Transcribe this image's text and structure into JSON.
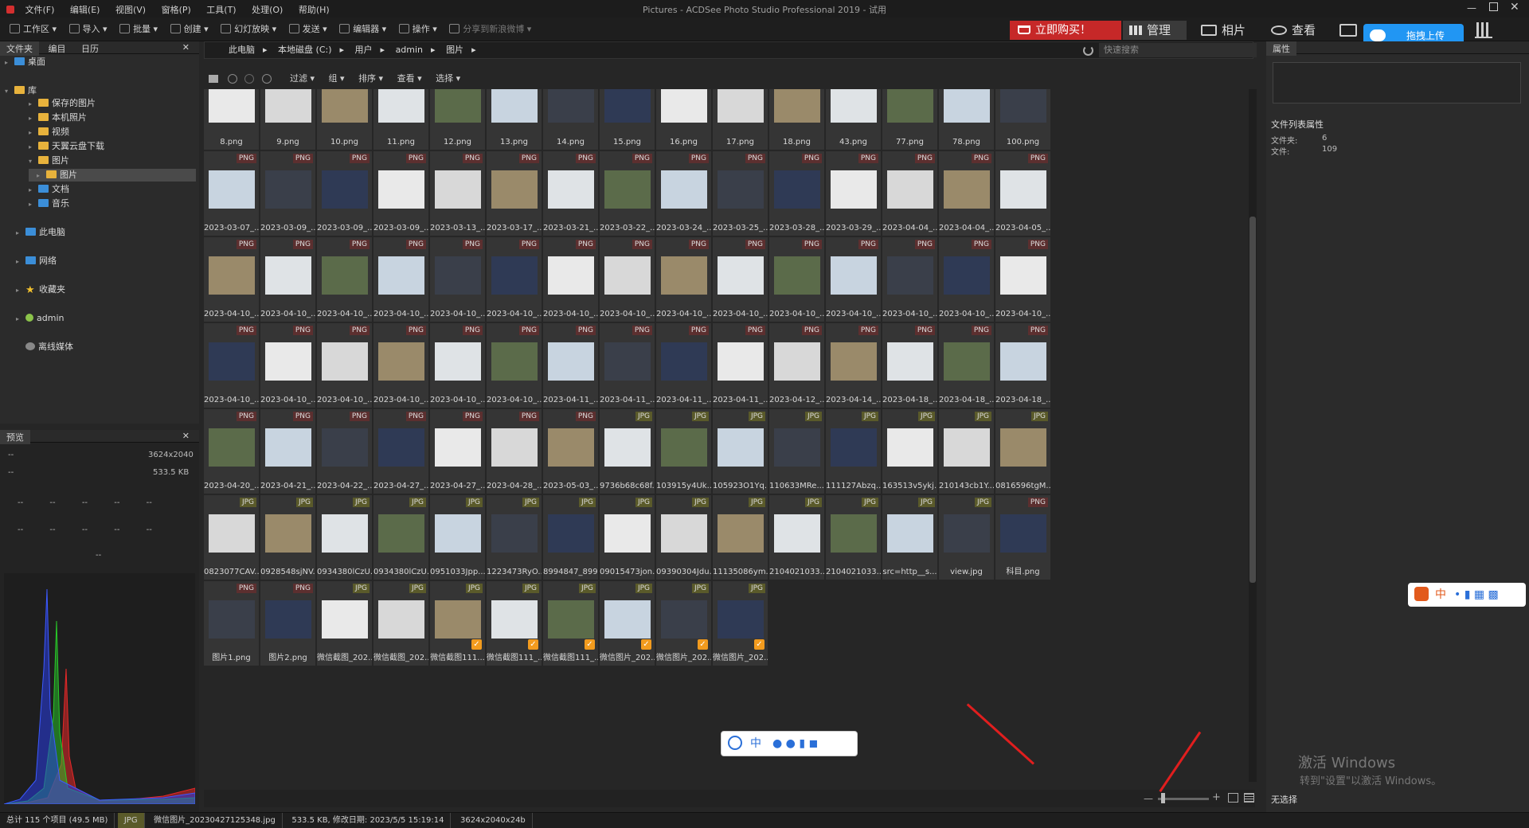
{
  "window": {
    "title": "Pictures - ACDSee Photo Studio Professional 2019 - 试用"
  },
  "menu": [
    "文件(F)",
    "编辑(E)",
    "视图(V)",
    "窗格(P)",
    "工具(T)",
    "处理(O)",
    "帮助(H)"
  ],
  "toolbar": {
    "items": [
      "工作区",
      "导入",
      "批量",
      "创建",
      "幻灯放映",
      "发送",
      "编辑器",
      "操作",
      "分享到新浪微博"
    ],
    "buy": "立即购买！",
    "modes": [
      "管理",
      "相片",
      "查看"
    ],
    "upload": "拖拽上传"
  },
  "left": {
    "tabs": [
      "文件夹",
      "编目",
      "日历"
    ],
    "tree": [
      {
        "label": "桌面",
        "icon": "desktop-icon"
      },
      {
        "label": "库",
        "icon": "folder-icon"
      },
      {
        "label": "保存的图片",
        "icon": "folder-icon"
      },
      {
        "label": "本机照片",
        "icon": "folder-icon"
      },
      {
        "label": "视频",
        "icon": "folder-icon"
      },
      {
        "label": "天翼云盘下载",
        "icon": "folder-icon"
      },
      {
        "label": "图片",
        "icon": "folder-icon"
      },
      {
        "label": "图片",
        "icon": "folder-icon"
      },
      {
        "label": "文档",
        "icon": "folder-icon"
      },
      {
        "label": "音乐",
        "icon": "folder-icon"
      },
      {
        "label": "此电脑",
        "icon": "computer-icon"
      },
      {
        "label": "网络",
        "icon": "network-icon"
      },
      {
        "label": "收藏夹",
        "icon": "star-icon"
      },
      {
        "label": "admin",
        "icon": "user-icon"
      },
      {
        "label": "离线媒体",
        "icon": "disc-icon"
      }
    ],
    "preview": {
      "title": "预览",
      "dash1": "--",
      "dims": "3624x2040",
      "dash2": "--",
      "size": "533.5 KB",
      "cell": "--"
    }
  },
  "path": {
    "crumbs": [
      "此电脑",
      "本地磁盘 (C:)",
      "用户",
      "admin",
      "图片"
    ],
    "search_placeholder": "快速搜索"
  },
  "filters": [
    "过滤",
    "组",
    "排序",
    "查看",
    "选择"
  ],
  "rows": [
    [
      "8.png",
      "9.png",
      "10.png",
      "11.png",
      "12.png",
      "13.png",
      "14.png",
      "15.png",
      "16.png",
      "17.png",
      "18.png",
      "43.png",
      "77.png",
      "78.png",
      "100.png"
    ],
    [
      "2023-03-07_...",
      "2023-03-09_...",
      "2023-03-09_...",
      "2023-03-09_...",
      "2023-03-13_...",
      "2023-03-17_...",
      "2023-03-21_...",
      "2023-03-22_...",
      "2023-03-24_...",
      "2023-03-25_...",
      "2023-03-28_...",
      "2023-03-29_...",
      "2023-04-04_...",
      "2023-04-04_...",
      "2023-04-05_..."
    ],
    [
      "2023-04-10_...",
      "2023-04-10_...",
      "2023-04-10_...",
      "2023-04-10_...",
      "2023-04-10_...",
      "2023-04-10_...",
      "2023-04-10_...",
      "2023-04-10_...",
      "2023-04-10_...",
      "2023-04-10_...",
      "2023-04-10_...",
      "2023-04-10_...",
      "2023-04-10_...",
      "2023-04-10_...",
      "2023-04-10_..."
    ],
    [
      "2023-04-10_...",
      "2023-04-10_...",
      "2023-04-10_...",
      "2023-04-10_...",
      "2023-04-10_...",
      "2023-04-10_...",
      "2023-04-11_...",
      "2023-04-11_...",
      "2023-04-11_...",
      "2023-04-11_...",
      "2023-04-12_...",
      "2023-04-14_...",
      "2023-04-18_...",
      "2023-04-18_...",
      "2023-04-18_..."
    ],
    [
      "2023-04-20_...",
      "2023-04-21_...",
      "2023-04-22_...",
      "2023-04-27_...",
      "2023-04-27_...",
      "2023-04-28_...",
      "2023-05-03_...",
      "9736b68c68f...",
      "103915y4Uk...",
      "105923O1Yq...",
      "110633MRe...",
      "111127Abzq...",
      "163513v5ykj...",
      "210143cb1Y...",
      "0816596tgM..."
    ],
    [
      "0823077CAV...",
      "0928548sjNV...",
      "0934380lCzU...",
      "0934380lCzU...",
      "0951033Jpp...",
      "1223473RyO...",
      "8994847_899...",
      "09015473jon...",
      "09390304Jdu...",
      "11135086ym...",
      "2104021033...",
      "2104021033...",
      "src=http__s...",
      "view.jpg",
      "科目.png"
    ],
    [
      "图片1.png",
      "图片2.png",
      "微信截图_202...",
      "微信截图_202...",
      "微信截图111...",
      "微信截图111_...",
      "微信截图111_...",
      "微信图片_202...",
      "微信图片_202...",
      "微信图片_202..."
    ]
  ],
  "props": {
    "title": "属性",
    "section": "文件列表属性",
    "folders_label": "文件夹:",
    "folders": "6",
    "files_label": "文件:",
    "files": "109",
    "none": "无选择"
  },
  "status": {
    "total": "总计 115 个项目 (49.5 MB)",
    "type": "JPG",
    "file": "微信图片_20230427125348.jpg",
    "info": "533.5 KB, 修改日期: 2023/5/5 15:19:14",
    "dims": "3624x2040x24b"
  },
  "watermark": {
    "line1": "激活 Windows",
    "line2": "转到\"设置\"以激活 Windows。"
  },
  "ime": {
    "main": "中",
    "side": "中"
  }
}
